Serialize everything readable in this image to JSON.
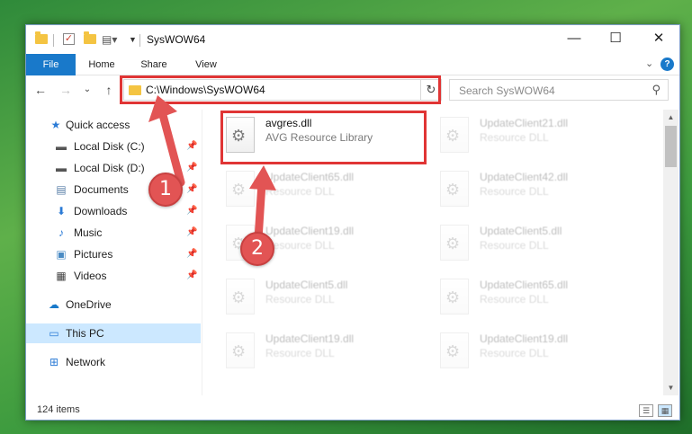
{
  "window": {
    "title": "SysWOW64",
    "minimize": "—",
    "maximize": "☐",
    "close": "✕"
  },
  "ribbon": {
    "tabs": [
      "File",
      "Home",
      "Share",
      "View"
    ],
    "expand": "⌄",
    "help": "?"
  },
  "navigation": {
    "back": "←",
    "forward": "→",
    "recent": "⌄",
    "up": "↑"
  },
  "address_bar": {
    "path": "C:\\Windows\\SysWOW64",
    "chevron": "⌄",
    "refresh": "↻"
  },
  "search": {
    "placeholder": "Search SysWOW64",
    "icon": "⚲"
  },
  "sidebar": {
    "items": [
      {
        "label": "Quick access",
        "icon": "★",
        "pinned": false
      },
      {
        "label": "Local Disk (C:)",
        "icon": "▬",
        "pinned": true
      },
      {
        "label": "Local Disk (D:)",
        "icon": "▬",
        "pinned": true
      },
      {
        "label": "Documents",
        "icon": "▤",
        "pinned": true
      },
      {
        "label": "Downloads",
        "icon": "⬇",
        "pinned": true
      },
      {
        "label": "Music",
        "icon": "♪",
        "pinned": true
      },
      {
        "label": "Pictures",
        "icon": "▣",
        "pinned": true
      },
      {
        "label": "Videos",
        "icon": "▦",
        "pinned": true
      },
      {
        "label": "OneDrive",
        "icon": "☁",
        "pinned": false
      },
      {
        "label": "This PC",
        "icon": "▭",
        "pinned": false
      },
      {
        "label": "Network",
        "icon": "⊞",
        "pinned": false
      }
    ],
    "pin_glyph": "📌"
  },
  "files": [
    {
      "name": "avgres.dll",
      "desc": "AVG Resource Library"
    },
    {
      "name": "UpdateClient21.dll",
      "desc": "Resource DLL"
    },
    {
      "name": "UpdateClient65.dll",
      "desc": "Resource DLL"
    },
    {
      "name": "UpdateClient42.dll",
      "desc": "Resource DLL"
    },
    {
      "name": "UpdateClient19.dll",
      "desc": "Resource DLL"
    },
    {
      "name": "UpdateClient5.dll",
      "desc": "Resource DLL"
    },
    {
      "name": "UpdateClient5.dll",
      "desc": "Resource DLL"
    },
    {
      "name": "UpdateClient65.dll",
      "desc": "Resource DLL"
    },
    {
      "name": "UpdateClient19.dll",
      "desc": "Resource DLL"
    },
    {
      "name": "UpdateClient19.dll",
      "desc": "Resource DLL"
    }
  ],
  "status": {
    "item_count": "124 items",
    "details_view": "☰",
    "tiles_view": "▦"
  },
  "callouts": [
    "1",
    "2"
  ],
  "colors": {
    "accent": "#1979ca",
    "highlight": "#e03535",
    "badge": "#e25454",
    "selection": "#cce8ff"
  }
}
